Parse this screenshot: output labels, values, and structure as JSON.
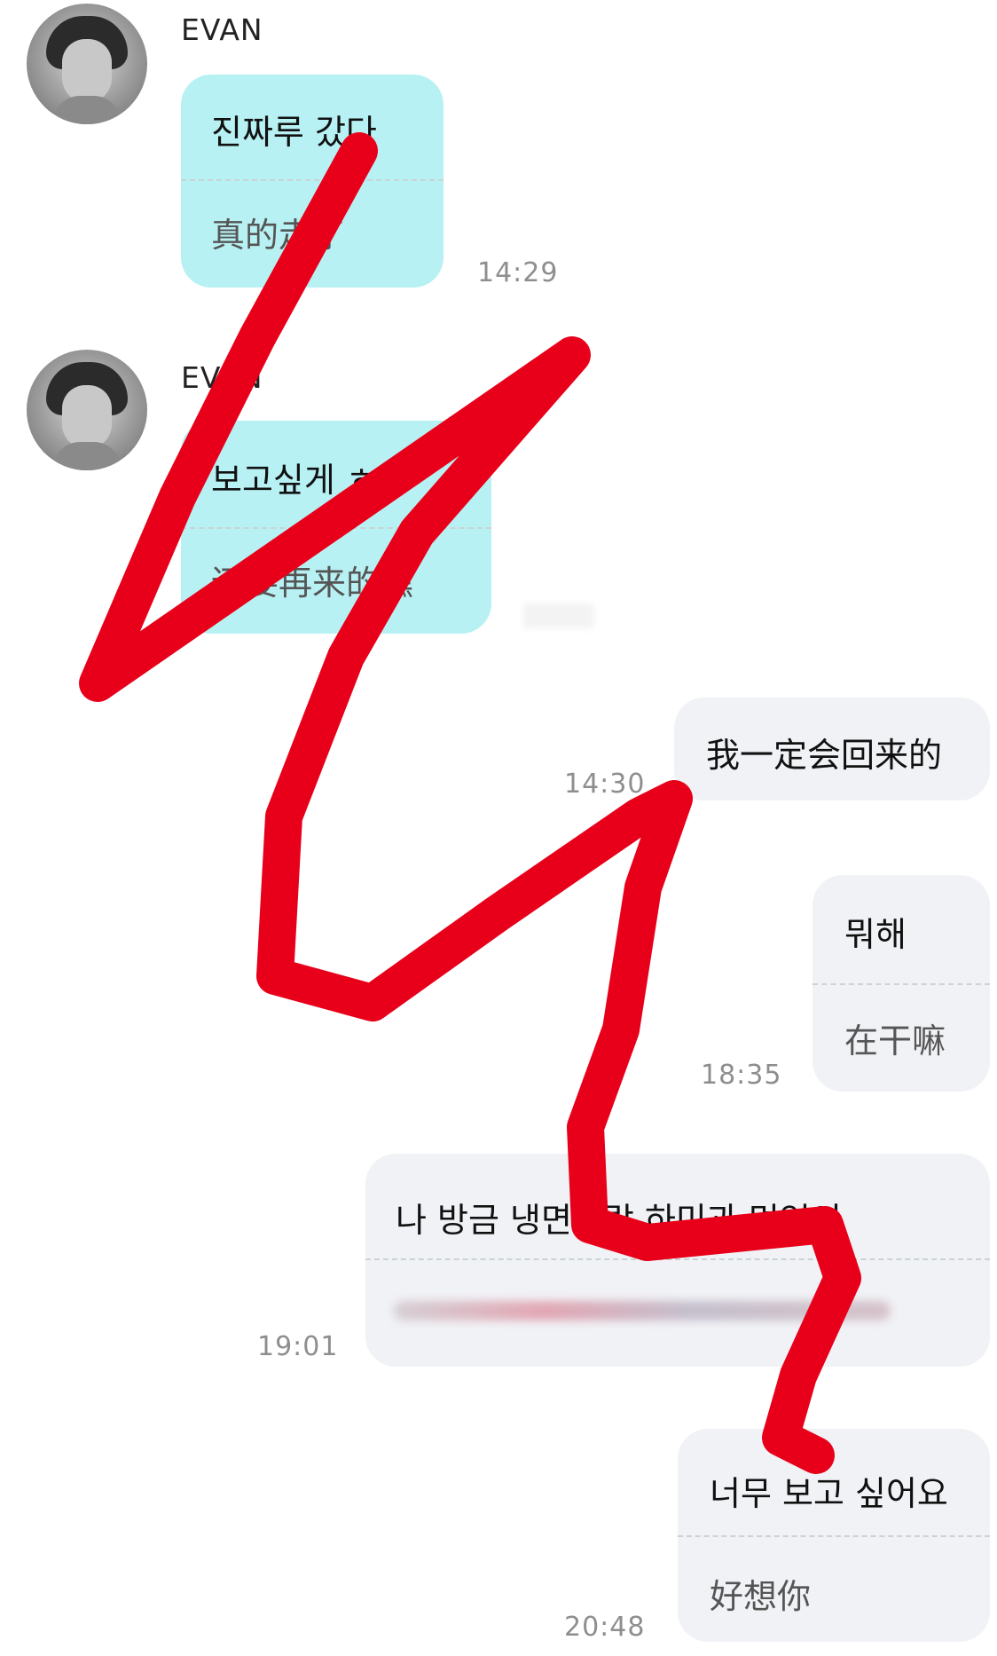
{
  "colors": {
    "incoming_bubble": "#b8f1f3",
    "outgoing_bubble": "#f1f2f6",
    "scribble": "#e8001a",
    "timestamp": "#8e8e8e"
  },
  "messages": [
    {
      "sender": "EVAN",
      "text": "진짜루 갔다",
      "translation": "真的走了",
      "time": "14:29"
    },
    {
      "sender": "EVAN",
      "text": "보고싶게 ㅎ",
      "translation": "还要再来的嘿",
      "time": ""
    },
    {
      "text": "我一定会回来的",
      "time": "14:30"
    },
    {
      "text": "뭐해",
      "translation": "在干嘛",
      "time": "18:35"
    },
    {
      "text": "나 방금 냉면이랑 하미과 먹었어",
      "translation": "",
      "time": "19:01"
    },
    {
      "text": "너무 보고 싶어요",
      "translation": "好想你",
      "time": "20:48"
    }
  ]
}
